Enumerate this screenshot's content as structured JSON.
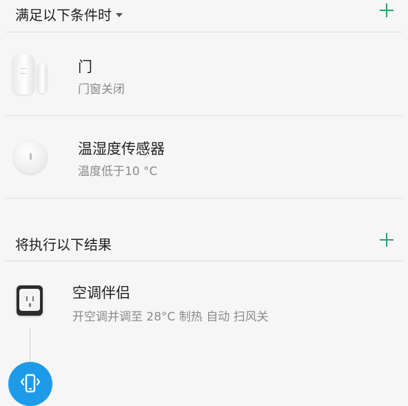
{
  "conditions": {
    "header": "满足以下条件时",
    "items": [
      {
        "title": "门",
        "subtitle": "门窗关闭",
        "icon": "door-window-sensor-icon"
      },
      {
        "title": "温湿度传感器",
        "subtitle": "温度低于10 °C",
        "icon": "temperature-humidity-sensor-icon"
      }
    ]
  },
  "results": {
    "header": "将执行以下结果",
    "items": [
      {
        "title": "空调伴侣",
        "subtitle": "开空调并调至 28°C 制热 自动 扫风关",
        "icon": "ac-companion-icon"
      }
    ],
    "next_action_icon": "phone-vibrate-icon"
  },
  "colors": {
    "accent_green": "#1fa36a",
    "action_blue": "#1e9be8",
    "background": "#f6f6f6"
  }
}
